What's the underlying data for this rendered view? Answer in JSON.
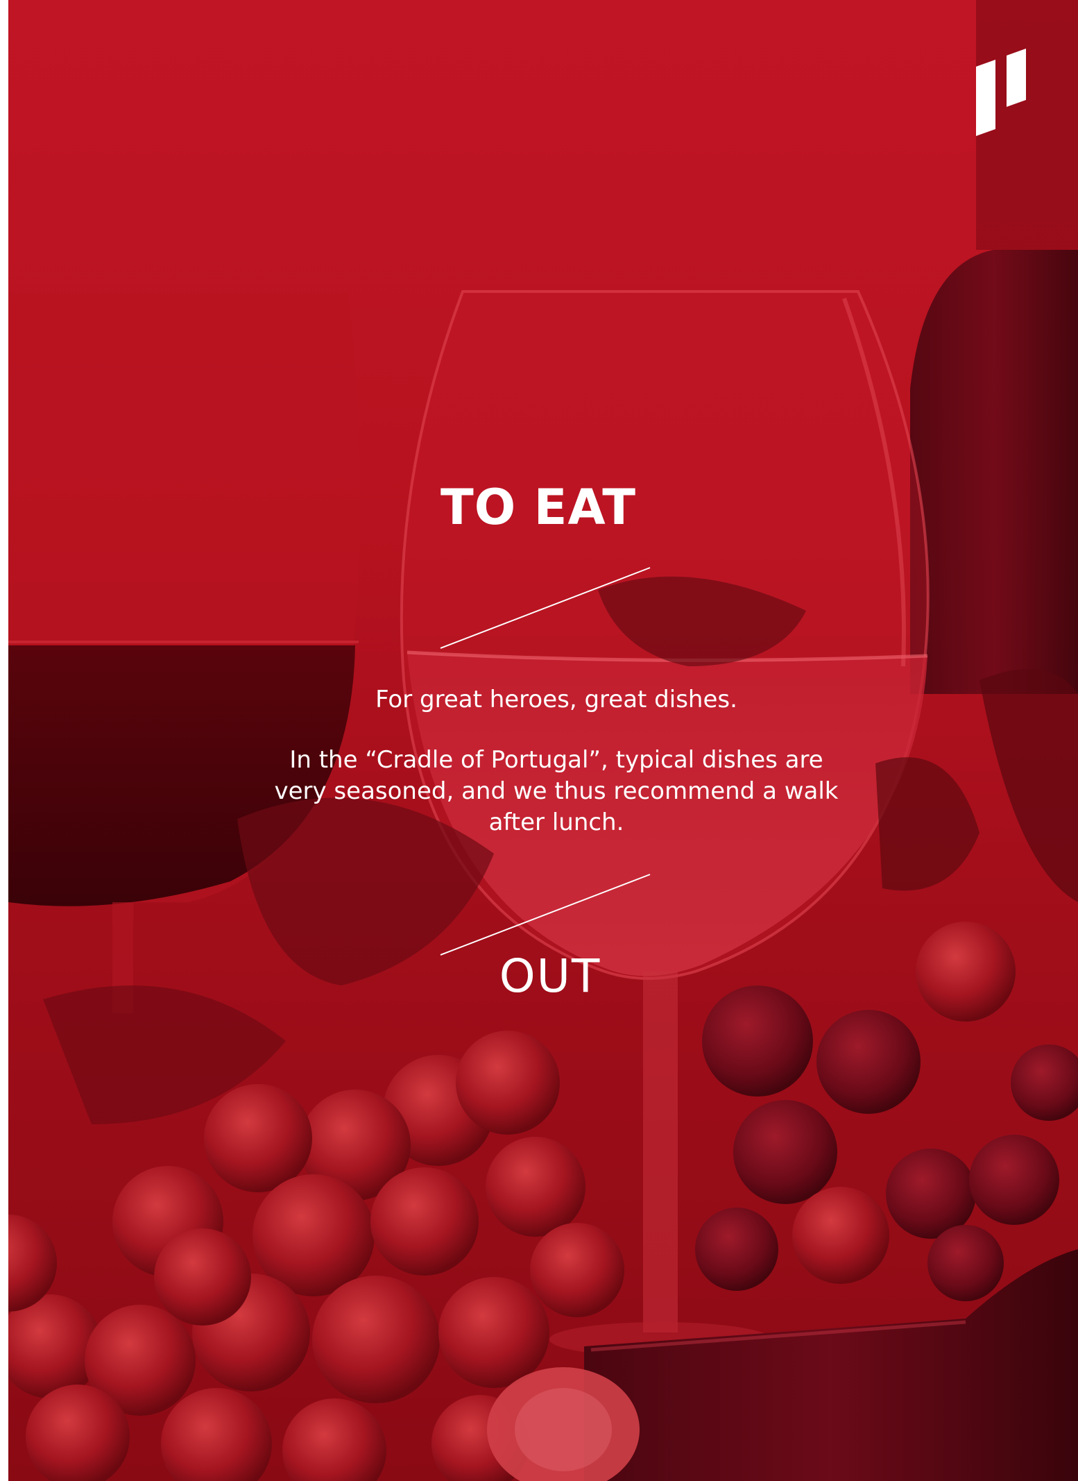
{
  "page": {
    "title": "TO EAT",
    "lead": "For great heroes, great dishes.",
    "paragraph": "In the “Cradle of Portugal”, typical dishes are very seasoned, and we thus recommend a walk after lunch.",
    "footer_title": "OUT"
  },
  "background": {
    "description_icon": "wine-glasses-and-grapes-photo",
    "tint_color": "#c01525"
  },
  "logo": {
    "icon": "brand-mark-logo"
  }
}
